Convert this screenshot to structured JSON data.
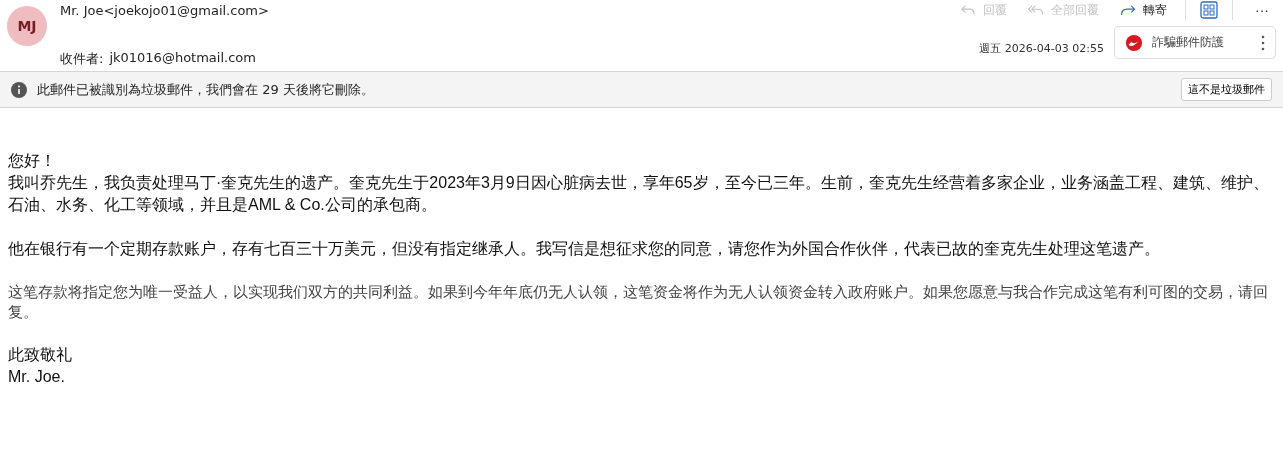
{
  "header": {
    "avatar": "MJ",
    "sender": "Mr. Joe<joekojo01@gmail.com>",
    "recipient_label": "收件者:",
    "recipient": "jk01016@hotmail.com",
    "date": "週五 2026-04-03 02:55"
  },
  "actions": [
    {
      "kind": "reply",
      "label": "回覆",
      "disabled": true
    },
    {
      "kind": "reply-all",
      "label": "全部回覆",
      "disabled": true
    },
    {
      "kind": "forward",
      "label": "轉寄",
      "disabled": false
    }
  ],
  "more": "···",
  "addin": {
    "label": "詐騙郵件防護"
  },
  "banner": {
    "message": "此郵件已被識別為垃圾郵件，我們會在 29 天後將它刪除。",
    "button": "這不是垃圾郵件"
  },
  "body": [
    {
      "kind": "sans",
      "lines": [
        "您好！",
        "我叫乔先生，我负责处理马丁·奎克先生的遗产。奎克先生于2023年3月9日因心脏病去世，享年65岁，至今已三年。生前，奎克先生经营着多家企业，业务涵盖工程、建筑、维护、石油、水务、化工等领域，并且是AML & Co.公司的承包商。"
      ]
    },
    {
      "kind": "sans",
      "lines": [
        "他在银行有一个定期存款账户，存有七百三十万美元，但没有指定继承人。我写信是想征求您的同意，请您作为外国合作伙伴，代表已故的奎克先生处理这笔遗产。"
      ]
    },
    {
      "kind": "serif",
      "lines": [
        "这笔存款将指定您为唯一受益人，以实现我们双方的共同利益。如果到今年年底仍无人认领，这笔资金将作为无人认领资金转入政府账户。如果您愿意与我合作完成这笔有利可图的交易，请回复。"
      ]
    },
    {
      "kind": "sans",
      "lines": [
        "此致敬礼",
        "Mr. Joe."
      ]
    }
  ]
}
